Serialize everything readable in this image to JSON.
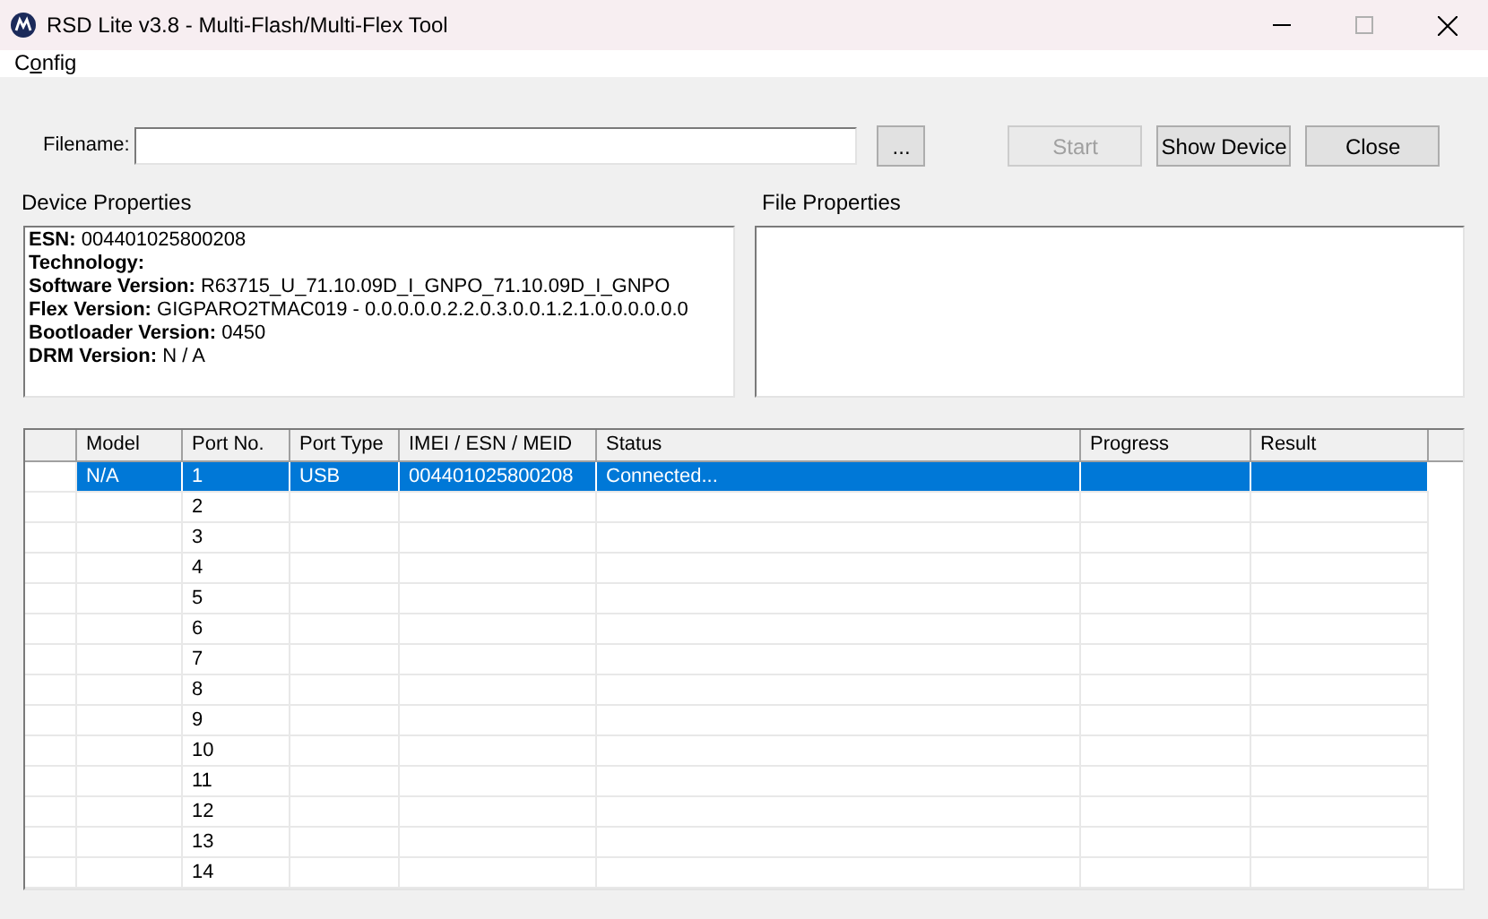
{
  "window": {
    "title": "RSD Lite v3.8 - Multi-Flash/Multi-Flex Tool"
  },
  "menu": [
    {
      "parts": [
        "C",
        "o",
        "nfig"
      ]
    }
  ],
  "filename": {
    "label": "Filename:"
  },
  "buttons": [
    {
      "label": "...",
      "disabled": false
    },
    {
      "label": "Start",
      "disabled": true
    },
    {
      "label": "Show Device",
      "disabled": false
    },
    {
      "label": "Close",
      "disabled": false
    }
  ],
  "device_properties": {
    "title": "Device Properties",
    "lines": [
      {
        "label": "ESN:",
        "value": "004401025800208"
      },
      {
        "label": "Technology:"
      },
      {
        "label": "Software Version:",
        "value": "R63715_U_71.10.09D_I_GNPO_71.10.09D_I_GNPO"
      },
      {
        "label": "Flex Version:",
        "value": "GIGPARO2TMAC019 - 0.0.0.0.0.2.2.0.3.0.0.1.2.1.0.0.0.0.0.0"
      },
      {
        "label": "Bootloader Version:",
        "value": "0450"
      },
      {
        "label": "DRM Version:",
        "value": "N / A"
      }
    ]
  },
  "file_properties": {
    "title": "File Properties"
  },
  "table": {
    "columns": [
      "Model",
      "Port No.",
      "Port Type",
      "IMEI / ESN / MEID",
      "Status",
      "Progress",
      "Result"
    ],
    "rows": [
      {
        "selected": true,
        "cells": [
          "N/A",
          "1",
          "USB",
          "004401025800208",
          "Connected...",
          "",
          ""
        ]
      },
      {
        "selected": false,
        "cells": [
          "",
          "2",
          "",
          "",
          "",
          "",
          ""
        ]
      },
      {
        "selected": false,
        "cells": [
          "",
          "3",
          "",
          "",
          "",
          "",
          ""
        ]
      },
      {
        "selected": false,
        "cells": [
          "",
          "4",
          "",
          "",
          "",
          "",
          ""
        ]
      },
      {
        "selected": false,
        "cells": [
          "",
          "5",
          "",
          "",
          "",
          "",
          ""
        ]
      },
      {
        "selected": false,
        "cells": [
          "",
          "6",
          "",
          "",
          "",
          "",
          ""
        ]
      },
      {
        "selected": false,
        "cells": [
          "",
          "7",
          "",
          "",
          "",
          "",
          ""
        ]
      },
      {
        "selected": false,
        "cells": [
          "",
          "8",
          "",
          "",
          "",
          "",
          ""
        ]
      },
      {
        "selected": false,
        "cells": [
          "",
          "9",
          "",
          "",
          "",
          "",
          ""
        ]
      },
      {
        "selected": false,
        "cells": [
          "",
          "10",
          "",
          "",
          "",
          "",
          ""
        ]
      },
      {
        "selected": false,
        "cells": [
          "",
          "11",
          "",
          "",
          "",
          "",
          ""
        ]
      },
      {
        "selected": false,
        "cells": [
          "",
          "12",
          "",
          "",
          "",
          "",
          ""
        ]
      },
      {
        "selected": false,
        "cells": [
          "",
          "13",
          "",
          "",
          "",
          "",
          ""
        ]
      },
      {
        "selected": false,
        "cells": [
          "",
          "14",
          "",
          "",
          "",
          "",
          ""
        ]
      }
    ]
  }
}
